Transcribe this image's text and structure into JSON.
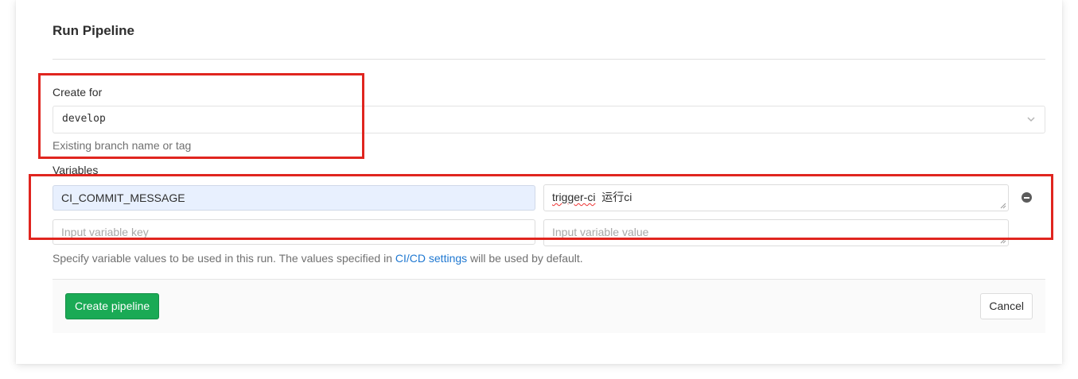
{
  "form": {
    "title": "Run Pipeline",
    "create_for_label": "Create for",
    "ref_value": "develop",
    "ref_help": "Existing branch name or tag",
    "variables_label": "Variables",
    "variables": [
      {
        "key": "CI_COMMIT_MESSAGE",
        "value_word1": "trigger-ci",
        "value_word2": "运行ci"
      },
      {
        "key_placeholder": "Input variable key",
        "value_placeholder": "Input variable value"
      }
    ],
    "variables_help_before": "Specify variable values to be used in this run. The values specified in ",
    "variables_help_link": "CI/CD settings",
    "variables_help_after": " will be used by default."
  },
  "footer": {
    "create_label": "Create pipeline",
    "cancel_label": "Cancel"
  },
  "colors": {
    "primary_green": "#1aaa55",
    "link_blue": "#1f78d1",
    "annotation_red": "#e0251f",
    "autofill_blue": "#e8f0fe"
  },
  "icons": {
    "select_chevron": "chevron-down-icon",
    "remove_variable": "remove-circle-icon",
    "textarea_resize": "resize-handle-icon"
  }
}
